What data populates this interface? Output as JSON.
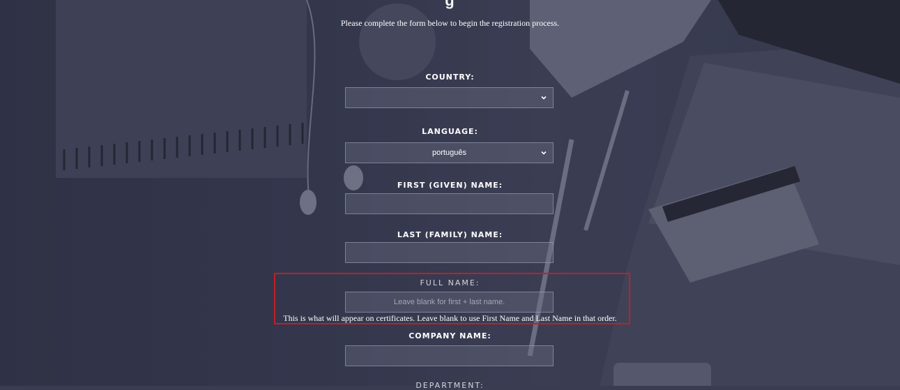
{
  "page": {
    "intro": "Please complete the form below to begin the registration process."
  },
  "form": {
    "country": {
      "label": "COUNTRY:",
      "value": ""
    },
    "language": {
      "label": "LANGUAGE:",
      "value": "português"
    },
    "first_name": {
      "label": "FIRST (GIVEN) NAME:",
      "value": ""
    },
    "last_name": {
      "label": "LAST (FAMILY) NAME:",
      "value": ""
    },
    "full_name": {
      "label": "FULL NAME:",
      "placeholder": "Leave blank for first + last name.",
      "help": "This is what will appear on certificates. Leave blank to use First Name and Last Name in that order."
    },
    "company_name": {
      "label": "COMPANY NAME:",
      "value": ""
    },
    "department": {
      "label": "DEPARTMENT:"
    }
  },
  "colors": {
    "highlight_border": "#c41e24",
    "background": "#3a3d52",
    "text": "#ffffff"
  }
}
